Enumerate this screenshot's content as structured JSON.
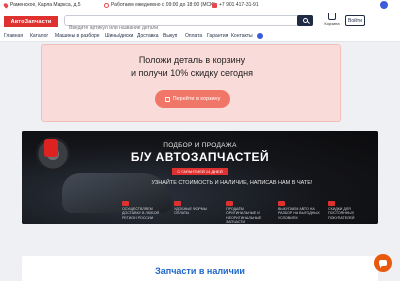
{
  "topbar": {
    "address": "Раменское, Карла Маркса, д.5",
    "hours": "Работаем ежедневно с 09:00 до 18:00 (MCK)",
    "phone": "+7 901 417-31-91"
  },
  "header": {
    "logo": "АвтоЗапчасти",
    "search_placeholder": "Введите артикул или название детали",
    "cart_label": "Корзина",
    "login_label": "Войти"
  },
  "nav": [
    "Главная",
    "Каталог",
    "Машины в разборе",
    "Шины/диски",
    "Доставка",
    "Выкуп",
    "Оплата",
    "Гарантия",
    "Контакты"
  ],
  "promo": {
    "line1": "Положи деталь в корзину",
    "line2": "и получи 10% скидку сегодня",
    "button": "Перейти в корзину"
  },
  "banner": {
    "sub1": "ПОДБОР И ПРОДАЖА",
    "title": "Б/У АВТОЗАПЧАСТЕЙ",
    "badge": "С ГАРАНТИЕЙ 14 ДНЕЙ",
    "sub2": "УЗНАЙТЕ СТОИМОСТЬ И НАЛИЧИЕ, НАПИСАВ НАМ В ЧАТЕ!",
    "features": [
      "ОСУЩЕСТВЛЯЕМ ДОСТАВКУ В ЛЮБОЙ РЕГИОН РОССИИ",
      "УДОБНЫЕ ФОРМЫ ОПЛАТЫ",
      "ПРОДАЁМ ОРИГИНАЛЬНЫЕ И НЕОРИГИНАЛЬНЫЕ ЗАПЧАСТИ",
      "ВЫКУПАЕМ АВТО НА РАЗБОР НА ВЫГОДНЫХ УСЛОВИЯХ",
      "СКИДКИ ДЛЯ ПОСТОЯННЫХ ПОКУПАТЕЛЕЙ"
    ]
  },
  "section": {
    "title": "Запчасти в наличии"
  },
  "colors": {
    "accent": "#e03131",
    "navy": "#1f2a44",
    "promo_bg": "#f9dcd9",
    "promo_button": "#f07767",
    "link_blue": "#1c66c9",
    "chat": "#e8590c"
  }
}
